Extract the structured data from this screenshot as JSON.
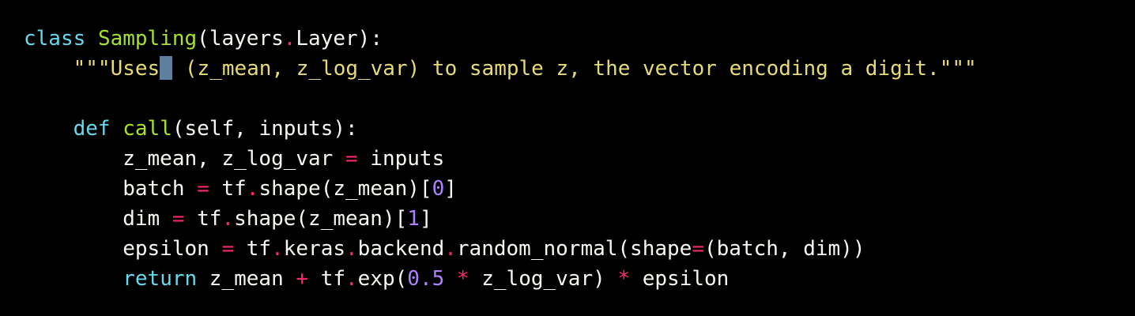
{
  "colors": {
    "background": "#000000",
    "default": "#f8f8f2",
    "keyword": "#66d9ef",
    "name": "#a6e22e",
    "operator": "#f92672",
    "string": "#e6db74",
    "number": "#ae81ff",
    "cursor": "#5f7fa0"
  },
  "code": {
    "lines": [
      {
        "tokens": [
          {
            "t": "class",
            "k": "keyword"
          },
          {
            "t": " ",
            "k": "default"
          },
          {
            "t": "Sampling",
            "k": "name"
          },
          {
            "t": "(layers",
            "k": "default"
          },
          {
            "t": ".",
            "k": "operator"
          },
          {
            "t": "Layer):",
            "k": "default"
          }
        ]
      },
      {
        "tokens": [
          {
            "t": "    ",
            "k": "default"
          },
          {
            "t": "\"\"\"Uses",
            "k": "string"
          },
          {
            "t": "",
            "k": "cursor"
          },
          {
            "t": " (z_mean, z_log_var) to sample z, the vector encoding a digit.\"\"\"",
            "k": "string"
          }
        ]
      },
      {
        "tokens": []
      },
      {
        "tokens": [
          {
            "t": "    ",
            "k": "default"
          },
          {
            "t": "def",
            "k": "keyword"
          },
          {
            "t": " ",
            "k": "default"
          },
          {
            "t": "call",
            "k": "name"
          },
          {
            "t": "(self, inputs):",
            "k": "default"
          }
        ]
      },
      {
        "tokens": [
          {
            "t": "        z_mean, z_log_var ",
            "k": "default"
          },
          {
            "t": "=",
            "k": "operator"
          },
          {
            "t": " inputs",
            "k": "default"
          }
        ]
      },
      {
        "tokens": [
          {
            "t": "        batch ",
            "k": "default"
          },
          {
            "t": "=",
            "k": "operator"
          },
          {
            "t": " tf",
            "k": "default"
          },
          {
            "t": ".",
            "k": "operator"
          },
          {
            "t": "shape(z_mean)[",
            "k": "default"
          },
          {
            "t": "0",
            "k": "number"
          },
          {
            "t": "]",
            "k": "default"
          }
        ]
      },
      {
        "tokens": [
          {
            "t": "        dim ",
            "k": "default"
          },
          {
            "t": "=",
            "k": "operator"
          },
          {
            "t": " tf",
            "k": "default"
          },
          {
            "t": ".",
            "k": "operator"
          },
          {
            "t": "shape(z_mean)[",
            "k": "default"
          },
          {
            "t": "1",
            "k": "number"
          },
          {
            "t": "]",
            "k": "default"
          }
        ]
      },
      {
        "tokens": [
          {
            "t": "        epsilon ",
            "k": "default"
          },
          {
            "t": "=",
            "k": "operator"
          },
          {
            "t": " tf",
            "k": "default"
          },
          {
            "t": ".",
            "k": "operator"
          },
          {
            "t": "keras",
            "k": "default"
          },
          {
            "t": ".",
            "k": "operator"
          },
          {
            "t": "backend",
            "k": "default"
          },
          {
            "t": ".",
            "k": "operator"
          },
          {
            "t": "random_normal(shape",
            "k": "default"
          },
          {
            "t": "=",
            "k": "operator"
          },
          {
            "t": "(batch, dim))",
            "k": "default"
          }
        ]
      },
      {
        "tokens": [
          {
            "t": "        ",
            "k": "default"
          },
          {
            "t": "return",
            "k": "keyword"
          },
          {
            "t": " z_mean ",
            "k": "default"
          },
          {
            "t": "+",
            "k": "operator"
          },
          {
            "t": " tf",
            "k": "default"
          },
          {
            "t": ".",
            "k": "operator"
          },
          {
            "t": "exp(",
            "k": "default"
          },
          {
            "t": "0.5",
            "k": "number"
          },
          {
            "t": " ",
            "k": "default"
          },
          {
            "t": "*",
            "k": "operator"
          },
          {
            "t": " z_log_var) ",
            "k": "default"
          },
          {
            "t": "*",
            "k": "operator"
          },
          {
            "t": " epsilon",
            "k": "default"
          }
        ]
      }
    ]
  }
}
